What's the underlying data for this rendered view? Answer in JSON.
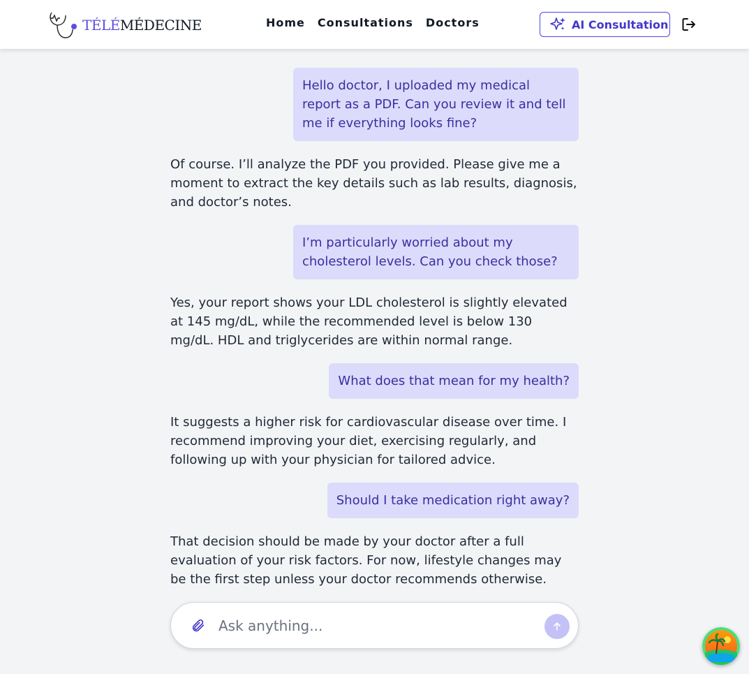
{
  "brand": {
    "part1": "TÉLÉ",
    "part2": "MÉDECINE",
    "accent_color": "#5b4ee0"
  },
  "nav": {
    "links": [
      "Home",
      "Consultations",
      "Doctors"
    ]
  },
  "ai_button": {
    "label": "AI Consultation",
    "icon": "sparkles-icon"
  },
  "logout": {
    "icon": "logout-icon"
  },
  "messages": [
    {
      "role": "user",
      "text": "Hello doctor, I uploaded my medical report as a PDF. Can you review it and tell me if everything looks fine?"
    },
    {
      "role": "assistant",
      "text": "Of course. I’ll analyze the PDF you provided. Please give me a moment to extract the key details such as lab results, diagnosis, and doctor’s notes."
    },
    {
      "role": "user",
      "text": "I’m particularly worried about my cholesterol levels. Can you check those?"
    },
    {
      "role": "assistant",
      "text": "Yes, your report shows your LDL cholesterol is slightly elevated at 145 mg/dL, while the recommended level is below 130 mg/dL. HDL and triglycerides are within normal range."
    },
    {
      "role": "user",
      "text": "What does that mean for my health?"
    },
    {
      "role": "assistant",
      "text": "It suggests a higher risk for cardiovascular disease over time. I recommend improving your diet, exercising regularly, and following up with your physician for tailored advice."
    },
    {
      "role": "user",
      "text": "Should I take medication right away?"
    },
    {
      "role": "assistant",
      "text": "That decision should be made by your doctor after a full evaluation of your risk factors. For now, lifestyle changes may be the first step unless your doctor recommends otherwise."
    }
  ],
  "composer": {
    "placeholder": "Ask anything...",
    "attach_icon": "paperclip-icon",
    "send_icon": "arrow-up-icon"
  },
  "colors": {
    "user_bubble": "#dcdbfc",
    "user_text": "#3b2f9e",
    "primary": "#4f46e5"
  }
}
